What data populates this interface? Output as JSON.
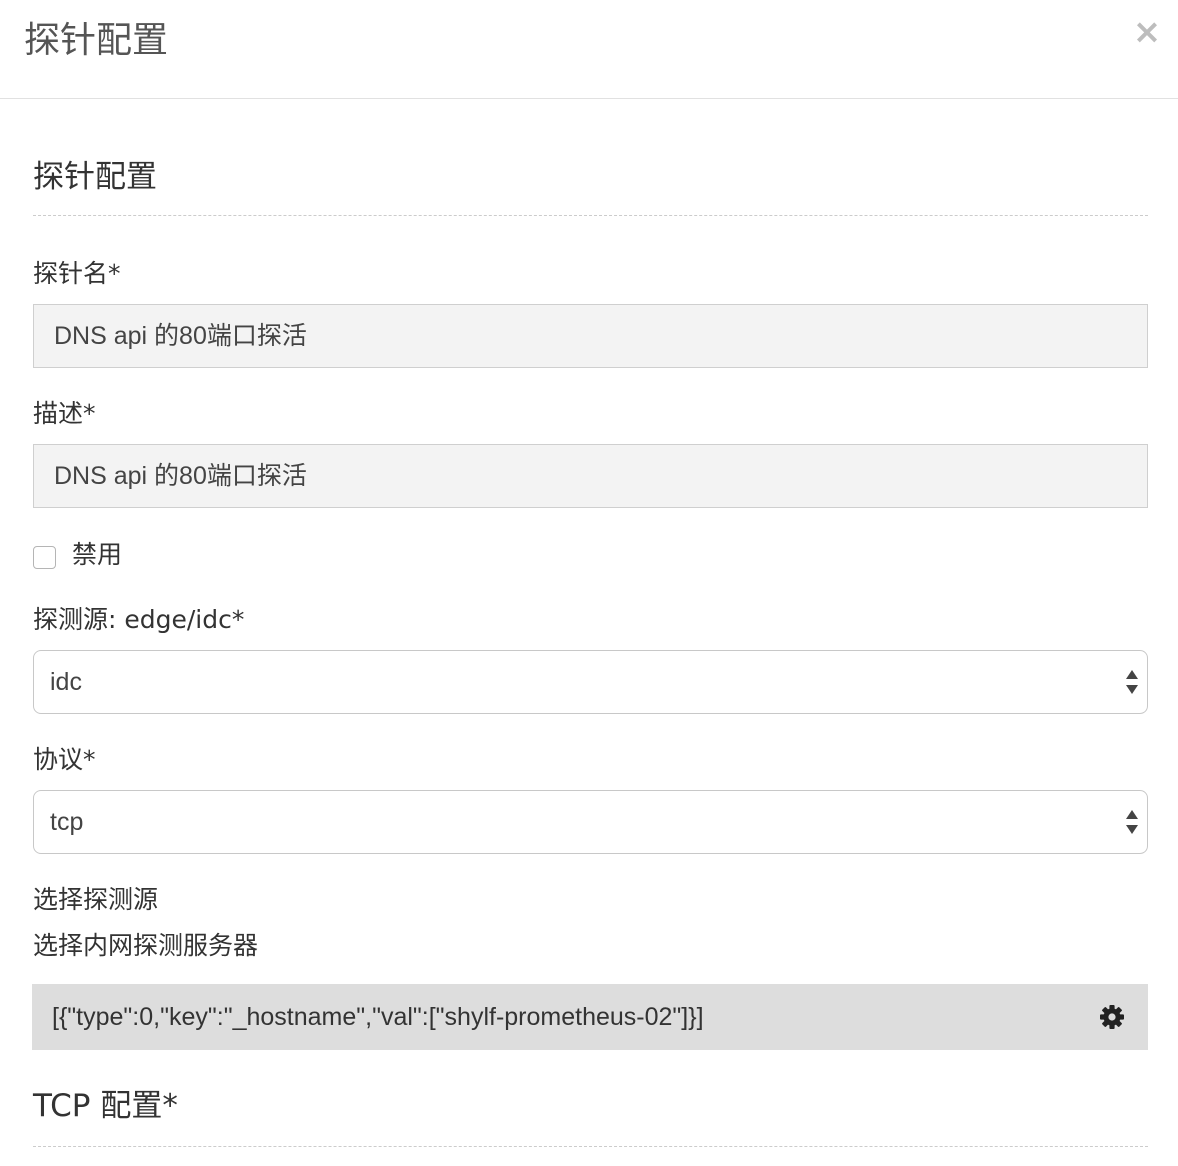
{
  "modal": {
    "title": "探针配置",
    "close_label": "×"
  },
  "form": {
    "section_title": "探针配置",
    "probe_name": {
      "label": "探针名*",
      "value": "DNS api 的80端口探活"
    },
    "description": {
      "label": "描述*",
      "value": "DNS api 的80端口探活"
    },
    "disable": {
      "label": "禁用",
      "checked": false
    },
    "probe_source": {
      "label": "探测源: edge/idc*",
      "value": "idc"
    },
    "protocol": {
      "label": "协议*",
      "value": "tcp"
    },
    "select_source": {
      "label": "选择探测源",
      "sublabel": "选择内网探测服务器",
      "value": "[{\"type\":0,\"key\":\"_hostname\",\"val\":[\"shylf-prometheus-02\"]}]",
      "icon": "gear-icon"
    },
    "tcp_section_title": "TCP 配置*"
  },
  "colors": {
    "input_bg": "#f3f3f3",
    "selector_bg": "#dddddd",
    "border": "#cfcfcf",
    "text": "#333333"
  }
}
